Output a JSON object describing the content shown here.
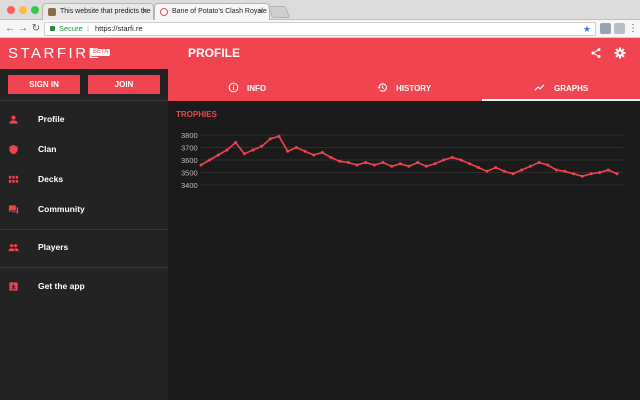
{
  "browser": {
    "tabs": [
      {
        "title": "This website that predicts the",
        "active": false
      },
      {
        "title": "Bane of Potato's Clash Royale",
        "active": true
      }
    ],
    "secure_label": "Secure",
    "url": "https://starfi.re"
  },
  "app": {
    "brand": "STARFIRE",
    "beta": "BETA",
    "accent_color": "#f04451",
    "auth": {
      "sign_in": "SIGN IN",
      "join": "JOIN"
    },
    "nav": [
      {
        "label": "Profile",
        "icon": "person-icon"
      },
      {
        "label": "Clan",
        "icon": "shield-icon"
      },
      {
        "label": "Decks",
        "icon": "grid-icon"
      },
      {
        "label": "Community",
        "icon": "forum-icon"
      },
      {
        "label": "Players",
        "icon": "people-icon"
      },
      {
        "label": "Get the app",
        "icon": "download-icon"
      }
    ],
    "page_title": "PROFILE",
    "tabs": [
      {
        "label": "INFO",
        "icon": "info-icon"
      },
      {
        "label": "HISTORY",
        "icon": "history-icon"
      },
      {
        "label": "GRAPHS",
        "icon": "trending-icon"
      }
    ]
  },
  "chart_data": {
    "type": "line",
    "title": "TROPHIES",
    "ylim": [
      3400,
      3800
    ],
    "yticks": [
      3400,
      3500,
      3600,
      3700,
      3800
    ],
    "grid": true,
    "series": [
      {
        "color": "#f04451",
        "values": [
          3560,
          3600,
          3640,
          3680,
          3740,
          3650,
          3680,
          3710,
          3770,
          3790,
          3670,
          3700,
          3670,
          3640,
          3660,
          3620,
          3590,
          3580,
          3560,
          3580,
          3560,
          3580,
          3550,
          3570,
          3550,
          3580,
          3550,
          3570,
          3600,
          3620,
          3600,
          3570,
          3540,
          3510,
          3540,
          3510,
          3490,
          3520,
          3550,
          3580,
          3560,
          3520,
          3510,
          3490,
          3470,
          3490,
          3500,
          3520,
          3490
        ]
      }
    ]
  }
}
